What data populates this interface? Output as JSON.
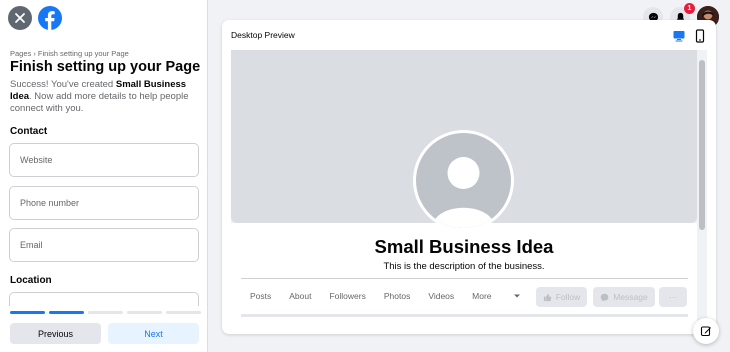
{
  "left": {
    "breadcrumb": "Pages › Finish setting up your Page",
    "title": "Finish setting up your Page",
    "success_prefix": "Success! You've created ",
    "success_name": "Small Business Idea",
    "success_suffix": ". Now add more details to help people connect with you.",
    "contact_label": "Contact",
    "fields": {
      "website": {
        "placeholder": "Website",
        "value": ""
      },
      "phone": {
        "placeholder": "Phone number",
        "value": ""
      },
      "email": {
        "placeholder": "Email",
        "value": ""
      }
    },
    "location_label": "Location",
    "progress": {
      "current_step": 2,
      "total_steps": 5
    },
    "prev_label": "Previous",
    "next_label": "Next"
  },
  "header": {
    "notification_count": "1",
    "icons": [
      "messenger-icon",
      "bell-icon",
      "avatar"
    ]
  },
  "preview": {
    "title": "Desktop Preview",
    "page_name": "Small Business Idea",
    "description": "This is the description of the business.",
    "tabs": [
      "Posts",
      "About",
      "Followers",
      "Photos",
      "Videos",
      "More"
    ],
    "follow_label": "Follow",
    "message_label": "Message",
    "more_actions_label": "···"
  },
  "colors": {
    "brand": "#1877f2",
    "badge": "#e41e3f",
    "cover": "#dadde1"
  }
}
